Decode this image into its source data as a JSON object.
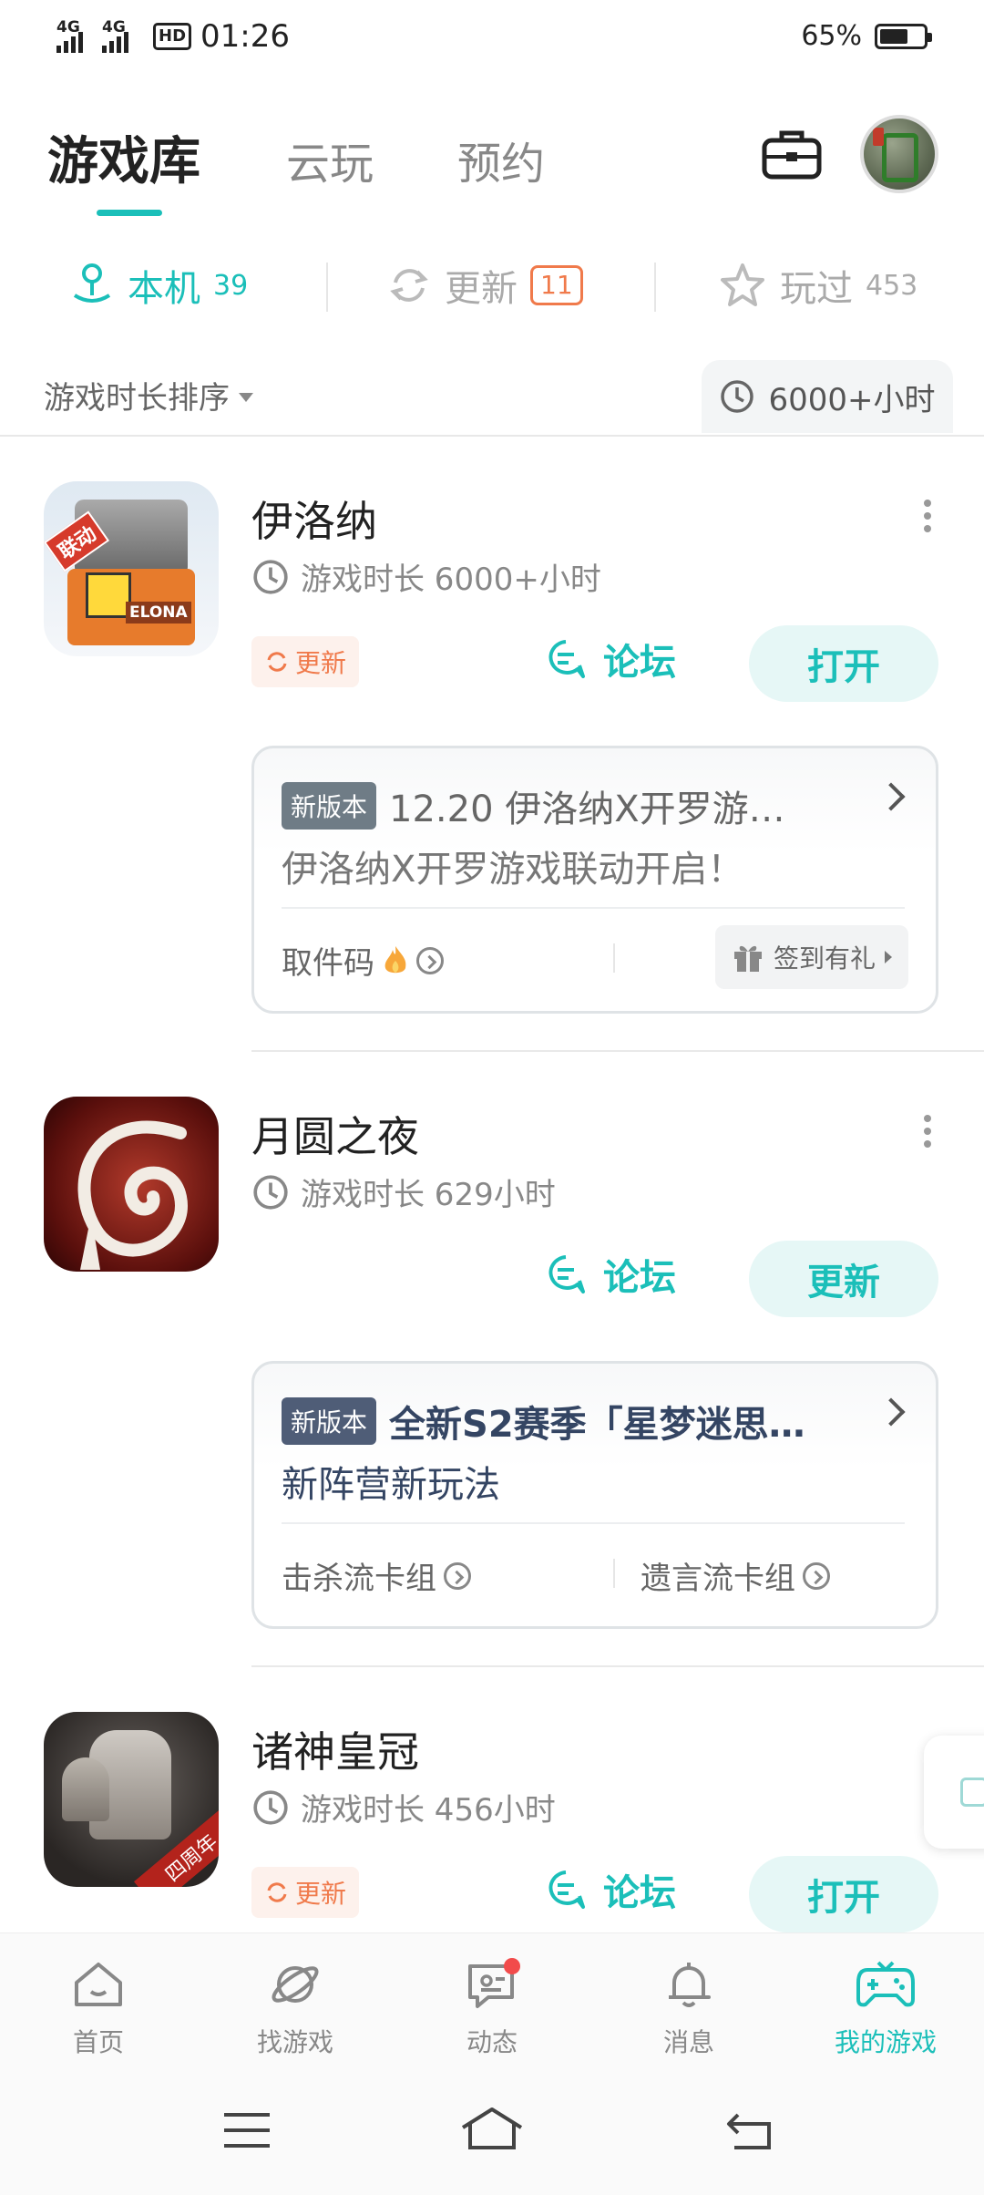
{
  "status": {
    "time": "01:26",
    "net1": "4G",
    "net2": "4G",
    "hd": "HD",
    "battery": "65%",
    "battery_level": 0.65
  },
  "topnav": {
    "tabs": [
      "游戏库",
      "云玩",
      "预约"
    ],
    "active": 0
  },
  "filters": [
    {
      "label": "本机",
      "count": "39"
    },
    {
      "label": "更新",
      "count": "11"
    },
    {
      "label": "玩过",
      "count": "453"
    }
  ],
  "sort": {
    "label": "游戏时长排序",
    "total": "6000+小时"
  },
  "games": [
    {
      "name": "伊洛纳",
      "playtime": "游戏时长 6000+小时",
      "update_tag": "更新",
      "forum": "论坛",
      "action": "打开",
      "icon_text": "ELONA",
      "icon_badge": "联动",
      "news": {
        "badge": "新版本",
        "title": "12.20 伊洛纳X开罗游…",
        "sub": "伊洛纳X开罗游戏联动开启！",
        "link1": "取件码",
        "link2": "签到有礼"
      }
    },
    {
      "name": "月圆之夜",
      "playtime": "游戏时长 629小时",
      "forum": "论坛",
      "action": "更新",
      "news": {
        "badge": "新版本",
        "title": "全新S2赛季「星梦迷思…",
        "sub": "新阵营新玩法",
        "link1": "击杀流卡组",
        "link2": "遗言流卡组"
      }
    },
    {
      "name": "诸神皇冠",
      "playtime": "游戏时长 456小时",
      "update_tag": "更新",
      "forum": "论坛",
      "action": "打开",
      "icon_badge": "四周年"
    }
  ],
  "bottomnav": [
    {
      "label": "首页",
      "icon": "home-icon"
    },
    {
      "label": "找游戏",
      "icon": "planet-icon"
    },
    {
      "label": "动态",
      "icon": "chat-icon"
    },
    {
      "label": "消息",
      "icon": "bell-icon"
    },
    {
      "label": "我的游戏",
      "icon": "gamepad-icon"
    }
  ],
  "colors": {
    "accent": "#1bbfb9",
    "orange": "#f07a4b"
  }
}
